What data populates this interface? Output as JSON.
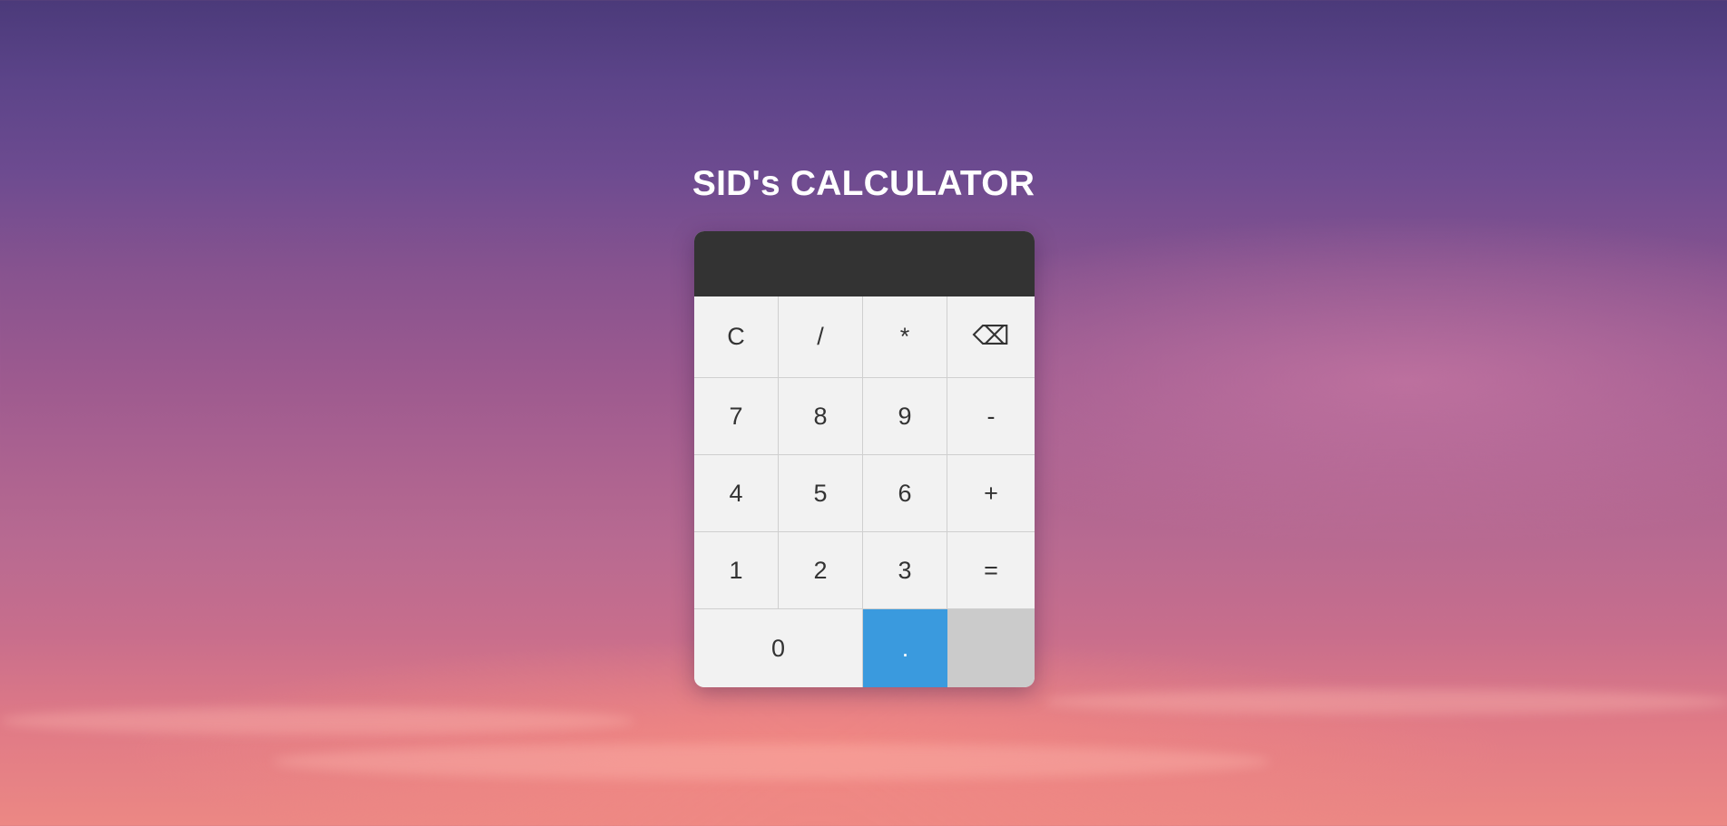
{
  "title": "SID's CALCULATOR",
  "display": {
    "value": ""
  },
  "keys": {
    "clear": "C",
    "divide": "/",
    "multiply": "*",
    "backspace": "⌫",
    "seven": "7",
    "eight": "8",
    "nine": "9",
    "minus": "-",
    "four": "4",
    "five": "5",
    "six": "6",
    "plus": "+",
    "one": "1",
    "two": "2",
    "three": "3",
    "equals": "=",
    "zero": "0",
    "dot": "."
  },
  "colors": {
    "display_bg": "#333333",
    "key_bg": "#f2f2f2",
    "dot_key_bg": "#3a9ade",
    "blank_key_bg": "#cbcbcb",
    "title_text": "#ffffff"
  },
  "icons": {
    "backspace": "backspace-icon"
  }
}
